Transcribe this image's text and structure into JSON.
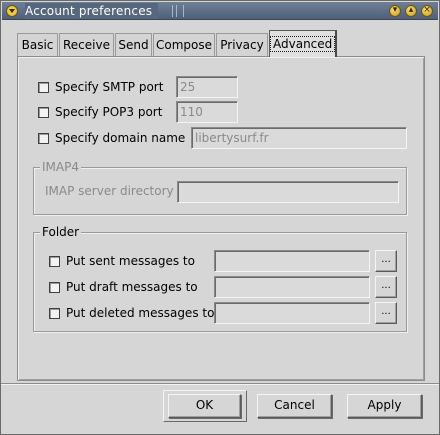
{
  "window": {
    "title": "Account preferences"
  },
  "tabs": [
    {
      "label": "Basic"
    },
    {
      "label": "Receive"
    },
    {
      "label": "Send"
    },
    {
      "label": "Compose"
    },
    {
      "label": "Privacy"
    },
    {
      "label": "Advanced",
      "active": true
    }
  ],
  "advanced": {
    "smtp_port": {
      "label": "Specify SMTP port",
      "value": "25",
      "checked": false
    },
    "pop3_port": {
      "label": "Specify POP3 port",
      "value": "110",
      "checked": false
    },
    "domain_name": {
      "label": "Specify domain name",
      "value": "libertysurf.fr",
      "checked": false
    },
    "imap": {
      "title": "IMAP4",
      "server_directory_label": "IMAP server directory",
      "server_directory_value": ""
    },
    "folder": {
      "title": "Folder",
      "sent": {
        "label": "Put sent messages to",
        "value": "",
        "browse": "..."
      },
      "draft": {
        "label": "Put draft messages to",
        "value": "",
        "browse": "..."
      },
      "deleted": {
        "label": "Put deleted messages to",
        "value": "",
        "browse": "..."
      }
    }
  },
  "buttons": {
    "ok": "OK",
    "cancel": "Cancel",
    "apply": "Apply"
  }
}
